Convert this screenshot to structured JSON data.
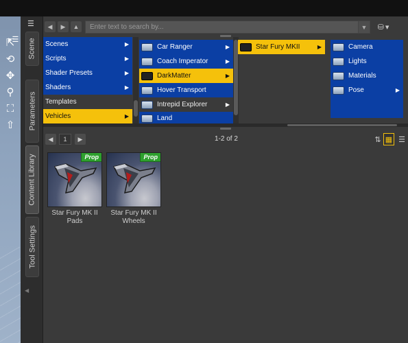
{
  "search": {
    "placeholder": "Enter text to search by..."
  },
  "side_tabs": [
    "Scene",
    "Parameters",
    "Content Library",
    "Tool Settings"
  ],
  "columns": {
    "col1": [
      "Scenes",
      "Scripts",
      "Shader Presets",
      "Shaders",
      "Templates",
      "Vehicles"
    ],
    "col2": [
      "Car Ranger",
      "Coach Imperator",
      "DarkMatter",
      "Hover Transport",
      "Intrepid Explorer",
      "Land"
    ],
    "col3": [
      "Star Fury MKII"
    ],
    "col4": [
      "Camera",
      "Lights",
      "Materials",
      "Pose"
    ]
  },
  "nav": {
    "page": "1",
    "count": "1-2 of 2"
  },
  "items": [
    {
      "badge": "Prop",
      "caption_line1": "Star Fury MK II",
      "caption_line2": "Pads"
    },
    {
      "badge": "Prop",
      "caption_line1": "Star Fury MK II",
      "caption_line2": "Wheels"
    }
  ],
  "colors": {
    "selected": "#f5c10b",
    "category_blue": "#0b3fa4",
    "prop_badge": "#2ea12e",
    "panel_bg": "#3a3a3a"
  },
  "icons": [
    "panel-menu-icon",
    "back-arrow-icon",
    "forward-arrow-icon",
    "up-arrow-icon",
    "dropdown-icon",
    "database-icon",
    "folder-icon",
    "chevron-right-icon",
    "viewport-tool-icons",
    "large-icons-view-icon",
    "list-view-icon",
    "sort-icon"
  ]
}
